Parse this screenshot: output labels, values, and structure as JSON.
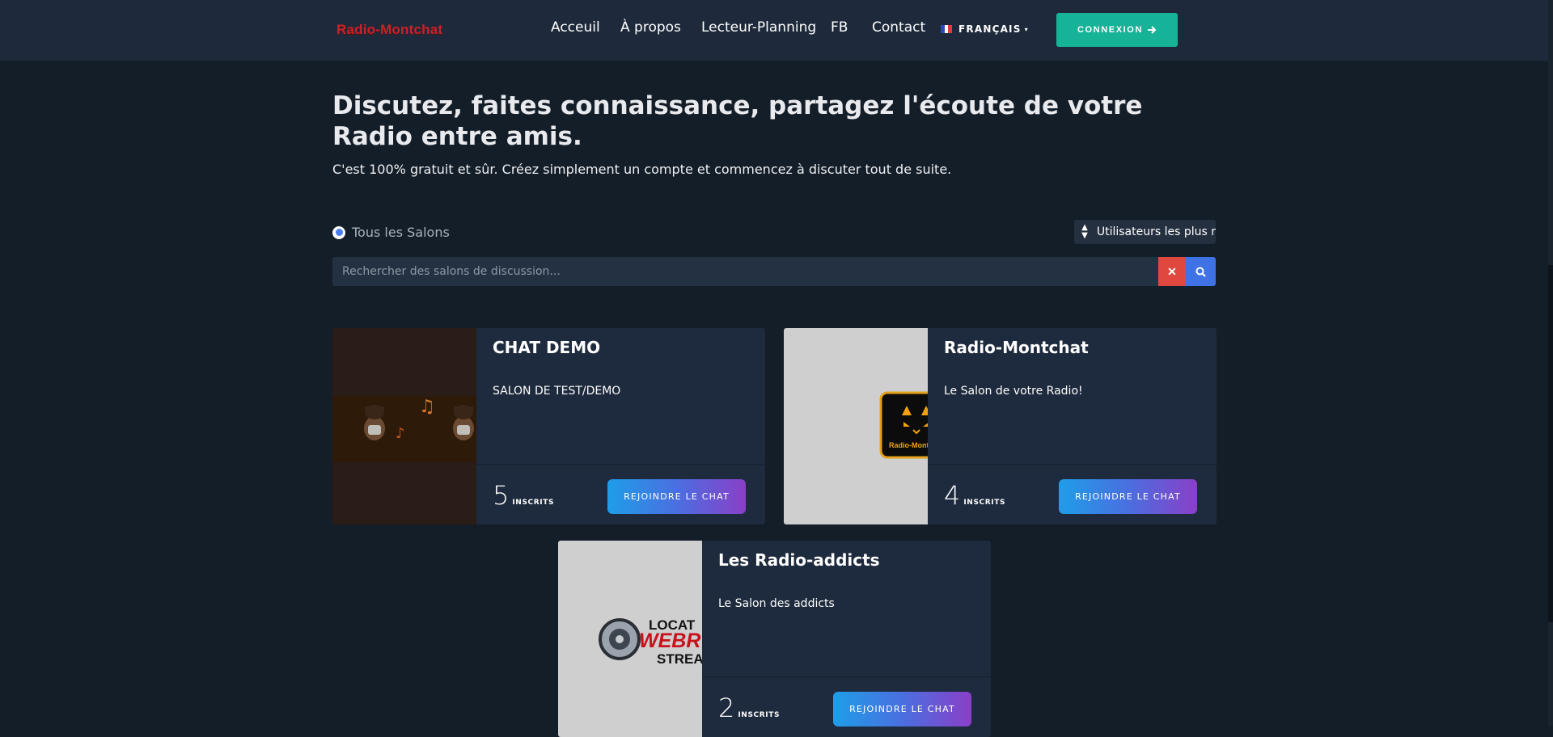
{
  "header": {
    "logo": "Radio-Montchat",
    "nav": [
      "Acceuil",
      "À propos",
      "Lecteur-Planning",
      "FB",
      "Contact"
    ],
    "language": "FRANÇAIS",
    "login_label": "CONNEXION"
  },
  "hero": {
    "title": "Discutez, faites connaissance, partagez l'écoute de votre Radio entre amis.",
    "subtitle": "C'est 100% gratuit et sûr. Créez simplement un compte et commencez à discuter tout de suite."
  },
  "filters": {
    "rooms_label": "Tous les Salons",
    "sort_label": "Utilisateurs les plus r"
  },
  "search": {
    "placeholder": "Rechercher des salons de discussion..."
  },
  "rooms": [
    {
      "title": "CHAT DEMO",
      "description": "SALON DE TEST/DEMO",
      "count": "5",
      "count_label": "INSCRITS",
      "join_label": "REJOINDRE LE CHAT"
    },
    {
      "title": "Radio-Montchat",
      "description": "Le Salon de votre Radio!",
      "count": "4",
      "count_label": "INSCRITS",
      "join_label": "REJOINDRE LE CHAT",
      "thumb_text": "Radio-Montchat"
    },
    {
      "title": "Les Radio-addicts",
      "description": "Le Salon des addicts",
      "count": "2",
      "count_label": "INSCRITS",
      "join_label": "REJOINDRE LE CHAT",
      "thumb_text": [
        "LOCAT",
        "WEBR",
        "STREA"
      ]
    }
  ],
  "colors": {
    "background": "#141e28",
    "header": "#1e2a3b",
    "card": "#1e2a3d",
    "accent_green": "#17b398",
    "accent_blue": "#3f72e4",
    "danger": "#e0483f",
    "logo_red": "#c8222a"
  },
  "icons": {
    "login": "arrow-right-icon",
    "sort": "sort-icon",
    "clear": "close-icon",
    "search": "search-icon",
    "language": "france-flag-icon"
  }
}
